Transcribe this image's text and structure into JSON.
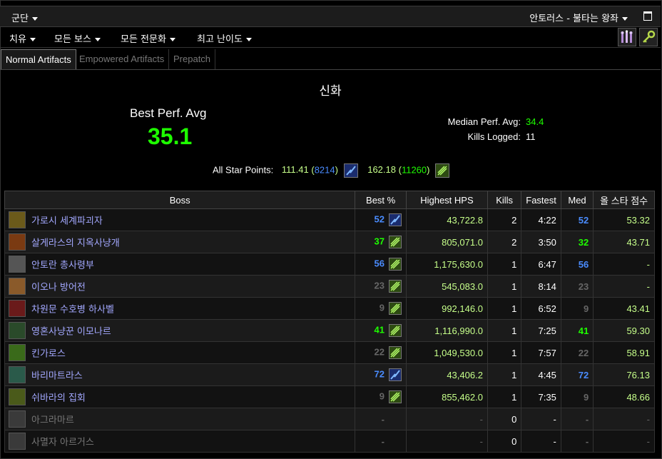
{
  "topbar": {
    "left_label": "군단",
    "right_label": "안토러스 - 불타는 왕좌"
  },
  "filters": [
    "치유",
    "모든 보스",
    "모든 전문화",
    "최고 난이도"
  ],
  "tabs": [
    "Normal Artifacts",
    "Empowered Artifacts",
    "Prepatch"
  ],
  "summary": {
    "difficulty": "신화",
    "best_label": "Best Perf. Avg",
    "best_value": "35.1",
    "median_label": "Median Perf. Avg:",
    "median_value": "34.4",
    "kills_label": "Kills Logged:",
    "kills_value": "11",
    "stars_label": "All Star Points:",
    "star1_points": "111.41",
    "star1_rank": "8214",
    "star2_points": "162.18",
    "star2_rank": "11260"
  },
  "columns": [
    "Boss",
    "Best %",
    "Highest HPS",
    "Kills",
    "Fastest",
    "Med",
    "올 스타 점수"
  ],
  "colors": {
    "blue": "#4a8cff",
    "green": "#1eff00",
    "grey": "#666666",
    "boss_name": "#a3a8ff"
  },
  "rows": [
    {
      "name": "가로시 세계파괴자",
      "best": "52",
      "best_color": "blue",
      "rank_icon": "blue",
      "hps": "43,722.8",
      "kills": "2",
      "fastest": "4:22",
      "med": "52",
      "med_color": "blue",
      "allstar": "53.32",
      "icon_color": "#6b5a1a"
    },
    {
      "name": "살게라스의 지옥사냥개",
      "best": "37",
      "best_color": "green",
      "rank_icon": "green",
      "hps": "805,071.0",
      "kills": "2",
      "fastest": "3:50",
      "med": "32",
      "med_color": "green",
      "allstar": "43.71",
      "icon_color": "#7a3a12"
    },
    {
      "name": "안토란 총사령부",
      "best": "56",
      "best_color": "blue",
      "rank_icon": "green",
      "hps": "1,175,630.0",
      "kills": "1",
      "fastest": "6:47",
      "med": "56",
      "med_color": "blue",
      "allstar": "-",
      "icon_color": "#555555"
    },
    {
      "name": "이오나 방어전",
      "best": "23",
      "best_color": "grey",
      "rank_icon": "green",
      "hps": "545,083.0",
      "kills": "1",
      "fastest": "8:14",
      "med": "23",
      "med_color": "grey",
      "allstar": "-",
      "icon_color": "#8a5a2a"
    },
    {
      "name": "차원문 수호병 하사벨",
      "best": "9",
      "best_color": "grey",
      "rank_icon": "green",
      "hps": "992,146.0",
      "kills": "1",
      "fastest": "6:52",
      "med": "9",
      "med_color": "grey",
      "allstar": "43.41",
      "icon_color": "#6a1a1a"
    },
    {
      "name": "영혼사냥꾼 이모나르",
      "best": "41",
      "best_color": "green",
      "rank_icon": "green",
      "hps": "1,116,990.0",
      "kills": "1",
      "fastest": "7:25",
      "med": "41",
      "med_color": "green",
      "allstar": "59.30",
      "icon_color": "#2a4a2a"
    },
    {
      "name": "킨가로스",
      "best": "22",
      "best_color": "grey",
      "rank_icon": "green",
      "hps": "1,049,530.0",
      "kills": "1",
      "fastest": "7:57",
      "med": "22",
      "med_color": "grey",
      "allstar": "58.91",
      "icon_color": "#3a6a1a"
    },
    {
      "name": "바리마트라스",
      "best": "72",
      "best_color": "blue",
      "rank_icon": "blue",
      "hps": "43,406.2",
      "kills": "1",
      "fastest": "4:45",
      "med": "72",
      "med_color": "blue",
      "allstar": "76.13",
      "icon_color": "#2a5a4a"
    },
    {
      "name": "쉬바라의 집회",
      "best": "9",
      "best_color": "grey",
      "rank_icon": "green",
      "hps": "855,462.0",
      "kills": "1",
      "fastest": "7:35",
      "med": "9",
      "med_color": "grey",
      "allstar": "48.66",
      "icon_color": "#4a5a1a"
    },
    {
      "name": "아그라마르",
      "best": "-",
      "best_color": "grey",
      "rank_icon": "",
      "hps": "-",
      "kills": "0",
      "fastest": "-",
      "med": "-",
      "med_color": "grey",
      "allstar": "-",
      "icon_color": "#3a3a3a",
      "dim": true
    },
    {
      "name": "사멸자 아르거스",
      "best": "-",
      "best_color": "grey",
      "rank_icon": "",
      "hps": "-",
      "kills": "0",
      "fastest": "-",
      "med": "-",
      "med_color": "grey",
      "allstar": "-",
      "icon_color": "#3a3a3a",
      "dim": true
    }
  ]
}
